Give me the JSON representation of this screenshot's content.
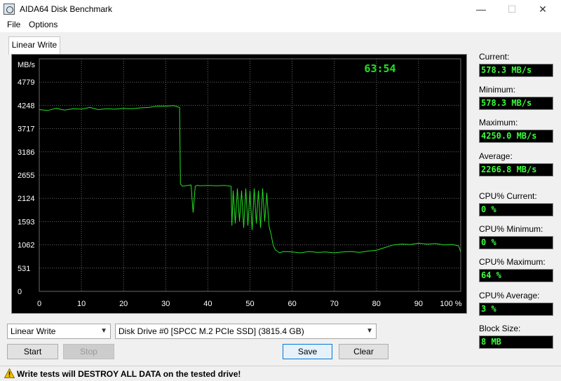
{
  "window": {
    "title": "AIDA64 Disk Benchmark",
    "minimize": "—",
    "maximize": "☐",
    "close": "✕"
  },
  "menu": {
    "file": "File",
    "options": "Options"
  },
  "tab": {
    "label": "Linear Write"
  },
  "chart_data": {
    "type": "line",
    "ylabel": "MB/s",
    "timer": "63:54",
    "y_ticks": [
      "0",
      "531",
      "1062",
      "1593",
      "2124",
      "2655",
      "3186",
      "3717",
      "4248",
      "4779"
    ],
    "x_ticks": [
      "0",
      "10",
      "20",
      "30",
      "40",
      "50",
      "60",
      "70",
      "80",
      "90",
      "100 %"
    ],
    "xlim": [
      0,
      100
    ],
    "ylim": [
      0,
      5310
    ],
    "line_color": "#22e022",
    "series": [
      {
        "x": [
          0,
          2,
          4,
          6,
          8,
          10,
          12,
          14,
          16,
          18,
          20,
          22,
          24,
          26,
          28,
          30,
          32,
          33.3,
          33.5,
          34,
          36,
          36.5,
          37,
          37.5,
          38,
          40,
          42,
          44,
          45.5,
          45.7,
          46,
          46.5,
          47,
          47.5,
          48,
          48.5,
          49,
          49.5,
          50,
          50.5,
          51,
          51.5,
          52,
          52.5,
          53,
          53.5,
          54,
          54.5,
          55,
          55.5,
          56,
          57,
          58,
          60,
          62,
          64,
          66,
          68,
          70,
          72,
          74,
          76,
          78,
          80,
          82,
          84,
          86,
          88,
          90,
          92,
          94,
          96,
          98,
          99.5,
          100
        ],
        "y": [
          4150,
          4130,
          4180,
          4140,
          4170,
          4160,
          4200,
          4150,
          4170,
          4160,
          4180,
          4170,
          4190,
          4200,
          4230,
          4230,
          4240,
          4200,
          2450,
          2400,
          2430,
          1800,
          2400,
          2420,
          2410,
          2420,
          2410,
          2420,
          2400,
          1500,
          2300,
          1550,
          2350,
          1600,
          2300,
          1450,
          2350,
          1500,
          2300,
          1400,
          2350,
          1550,
          2300,
          1450,
          2350,
          1600,
          2250,
          1500,
          1300,
          1050,
          950,
          880,
          910,
          900,
          880,
          910,
          890,
          900,
          880,
          900,
          910,
          890,
          920,
          940,
          1000,
          1060,
          1080,
          1070,
          1100,
          1080,
          1090,
          1060,
          1070,
          1040,
          900
        ]
      }
    ]
  },
  "stats": {
    "current_label": "Current:",
    "current_value": "578.3 MB/s",
    "minimum_label": "Minimum:",
    "minimum_value": "578.3 MB/s",
    "maximum_label": "Maximum:",
    "maximum_value": "4250.0 MB/s",
    "average_label": "Average:",
    "average_value": "2266.8 MB/s",
    "cpu_current_label": "CPU% Current:",
    "cpu_current_value": "0 %",
    "cpu_minimum_label": "CPU% Minimum:",
    "cpu_minimum_value": "0 %",
    "cpu_maximum_label": "CPU% Maximum:",
    "cpu_maximum_value": "64 %",
    "cpu_average_label": "CPU% Average:",
    "cpu_average_value": "3 %",
    "block_size_label": "Block Size:",
    "block_size_value": "8 MB"
  },
  "controls": {
    "test_select": "Linear Write",
    "drive_select": "Disk Drive #0  [SPCC M.2 PCIe SSD]  (3815.4 GB)",
    "start": "Start",
    "stop": "Stop",
    "save": "Save",
    "clear": "Clear"
  },
  "status": {
    "warning": "Write tests will DESTROY ALL DATA on the tested drive!"
  },
  "colors": {
    "value_text": "#3cff3c",
    "chart_bg": "#000000",
    "grid": "#6a6a6a",
    "timer": "#22e022",
    "accent": "#0078d7"
  }
}
